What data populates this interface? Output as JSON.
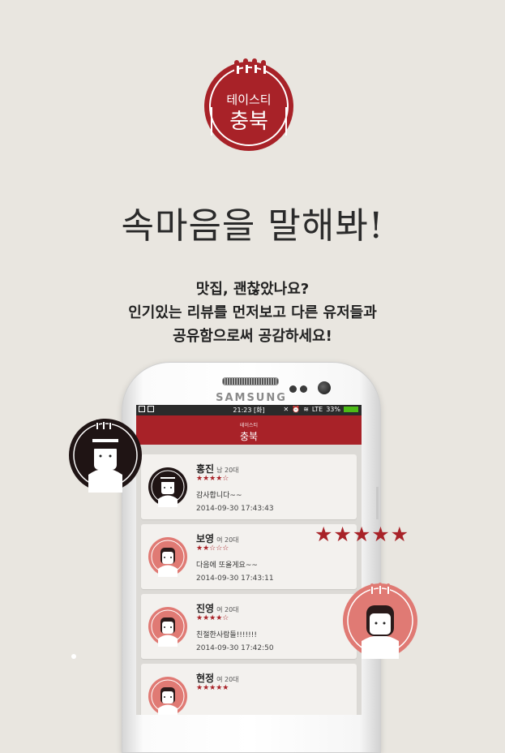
{
  "logo": {
    "top": "테이스티",
    "bottom": "충북"
  },
  "headline": "속마음을 말해봐!",
  "intro": [
    "맛집, 괜찮았나요?",
    "인기있는 리뷰를 먼저보고 다른 유저들과",
    "공유함으로써 공감하세요!"
  ],
  "phone": {
    "brand": "SAMSUNG",
    "status": {
      "time": "21:23 [화]",
      "network": "LTE",
      "battery": "33%"
    },
    "appbar": {
      "small": "테이스티",
      "big": "충북"
    }
  },
  "reviews": [
    {
      "name": "홍진",
      "meta": "남 20대",
      "stars": "★★★★☆",
      "rating": 4,
      "text": "감사합니다~~",
      "date": "2014-09-30 17:43:43",
      "avatar": "male"
    },
    {
      "name": "보영",
      "meta": "여 20대",
      "stars": "★★☆☆☆",
      "rating": 2,
      "text": "다음에 또올게요~~",
      "date": "2014-09-30 17:43:11",
      "avatar": "female"
    },
    {
      "name": "진영",
      "meta": "여 20대",
      "stars": "★★★★☆",
      "rating": 4,
      "text": "친절한사람들!!!!!!!",
      "date": "2014-09-30 17:42:50",
      "avatar": "female"
    },
    {
      "name": "현정",
      "meta": "여 20대",
      "stars": "★★★★★",
      "rating": 5,
      "text": "",
      "date": "",
      "avatar": "female"
    }
  ],
  "big_stars": "★★★★★",
  "colors": {
    "brand_red": "#a82228",
    "background": "#e9e6e0",
    "avatar_pink": "#e07a74"
  }
}
